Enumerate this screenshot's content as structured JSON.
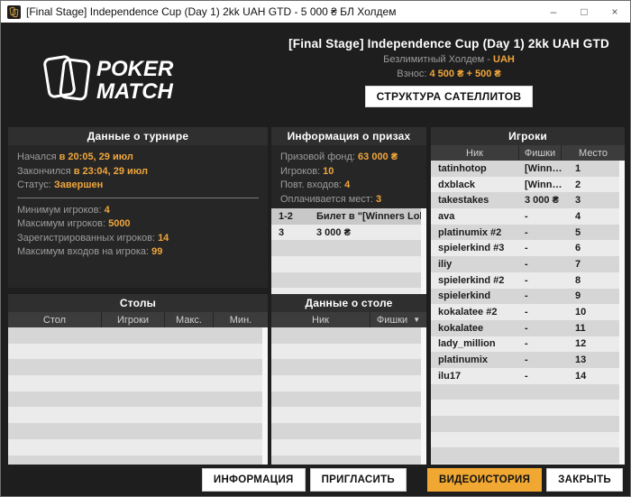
{
  "colors": {
    "accent": "#F0A63C",
    "orange_button": "#F0A832",
    "stripe_dark": "#D6D6D6",
    "stripe_light": "#EBEBEB",
    "selected_row": "#C8C8C8"
  },
  "icons": {
    "sort_caret": "▼",
    "minimize": "–",
    "maximize": "□",
    "close": "×"
  },
  "window": {
    "title": "[Final Stage] Independence Cup (Day 1) 2kk UAH GTD - 5 000 ₴ БЛ Холдем"
  },
  "header": {
    "logo_line1": "POKER",
    "logo_line2": "MATCH",
    "title": "[Final Stage] Independence Cup (Day 1) 2kk UAH GTD",
    "game_label": "Безлимитный Холдем -",
    "currency": "UAH",
    "buyin_label": "Взнос:",
    "buyin_value": "4 500 ₴ + 500 ₴",
    "satellites_button": "СТРУКТУРА САТЕЛЛИТОВ"
  },
  "tournament_data": {
    "title": "Данные о турнире",
    "rows_top": [
      {
        "label": "Начался",
        "value": "в 20:05, 29 июл"
      },
      {
        "label": "Закончился",
        "value": "в 23:04, 29 июл"
      },
      {
        "label": "Статус:",
        "value": "Завершен"
      }
    ],
    "rows_bottom": [
      {
        "label": "Минимум игроков:",
        "value": "4"
      },
      {
        "label": "Максимум игроков:",
        "value": "5000"
      },
      {
        "label": "Зарегистрированных игроков:",
        "value": "14"
      },
      {
        "label": "Максимум входов на игрока:",
        "value": "99"
      }
    ]
  },
  "prize_info": {
    "title": "Информация о призах",
    "rows": [
      {
        "label": "Призовой фонд:",
        "value": "63 000 ₴"
      },
      {
        "label": "Игроков:",
        "value": "10"
      },
      {
        "label": "Повт. входов:",
        "value": "4"
      },
      {
        "label": "Оплачивается мест:",
        "value": "3"
      }
    ],
    "table": [
      {
        "place": "1-2",
        "prize": "Билет в \"[Winners Lob…"
      },
      {
        "place": "3",
        "prize": "3 000 ₴"
      }
    ]
  },
  "tables_panel": {
    "title": "Столы",
    "columns": [
      "Стол",
      "Игроки",
      "Макс.",
      "Мин."
    ]
  },
  "table_data_panel": {
    "title": "Данные о столе",
    "columns": [
      "Ник",
      "Фишки"
    ]
  },
  "players": {
    "title": "Игроки",
    "columns": [
      "Ник",
      "Фишки",
      "Место"
    ],
    "rows": [
      {
        "nick": "tatinhotop",
        "chips": "[Winn…",
        "place": "1"
      },
      {
        "nick": "dxblack",
        "chips": "[Winn…",
        "place": "2"
      },
      {
        "nick": "takestakes",
        "chips": "3 000 ₴",
        "place": "3"
      },
      {
        "nick": "ava",
        "chips": "-",
        "place": "4"
      },
      {
        "nick": "platinumix #2",
        "chips": "-",
        "place": "5"
      },
      {
        "nick": "spielerkind #3",
        "chips": "-",
        "place": "6"
      },
      {
        "nick": "iliy",
        "chips": "-",
        "place": "7"
      },
      {
        "nick": "spielerkind #2",
        "chips": "-",
        "place": "8"
      },
      {
        "nick": "spielerkind",
        "chips": "-",
        "place": "9"
      },
      {
        "nick": "kokalatee #2",
        "chips": "-",
        "place": "10"
      },
      {
        "nick": "kokalatee",
        "chips": "-",
        "place": "11"
      },
      {
        "nick": "lady_million",
        "chips": "-",
        "place": "12"
      },
      {
        "nick": "platinumix",
        "chips": "-",
        "place": "13"
      },
      {
        "nick": "ilu17",
        "chips": "-",
        "place": "14"
      }
    ]
  },
  "footer": {
    "buttons": [
      {
        "label": "ИНФОРМАЦИЯ"
      },
      {
        "label": "ПРИГЛАСИТЬ"
      },
      {
        "label": "ВИДЕОИСТОРИЯ"
      },
      {
        "label": "ЗАКРЫТЬ"
      }
    ]
  }
}
